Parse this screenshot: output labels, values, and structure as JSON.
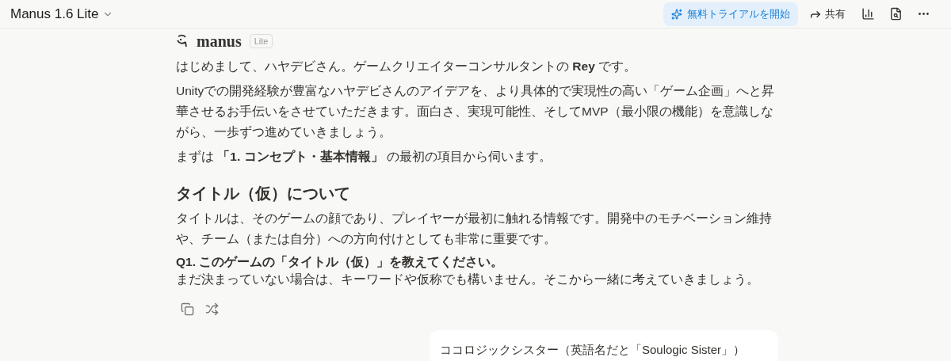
{
  "header": {
    "model": "Manus 1.6 Lite",
    "trial_button": "無料トライアルを開始",
    "share_button": "共有"
  },
  "message": {
    "brand": "manus",
    "badge": "Lite",
    "paragraphs": [
      "はじめまして、ハヤデビさん。ゲームクリエイターコンサルタントの **Rey** です。",
      "Unityでの開発経験が豊富なハヤデビさんのアイデアを、より具体的で実現性の高い「ゲーム企画」へと昇華させるお手伝いをさせていただきます。面白さ、実現可能性、そしてMVP（最小限の機能）を意識しながら、一歩ずつ進めていきましょう。",
      "まずは **「1. コンセプト・基本情報」** の最初の項目から伺います。"
    ],
    "heading": "タイトル（仮）について",
    "body": "タイトルは、そのゲームの顔であり、プレイヤーが最初に触れる情報です。開発中のモチベーション維持や、チーム（または自分）への方向付けとしても非常に重要です。",
    "question": "Q1. このゲームの「タイトル（仮）」を教えてください。",
    "note": "まだ決まっていない場合は、キーワードや仮称でも構いません。そこから一緒に考えていきましょう。"
  },
  "user_message": "ココロジックシスター（英語名だと「Soulogic Sister」）"
}
